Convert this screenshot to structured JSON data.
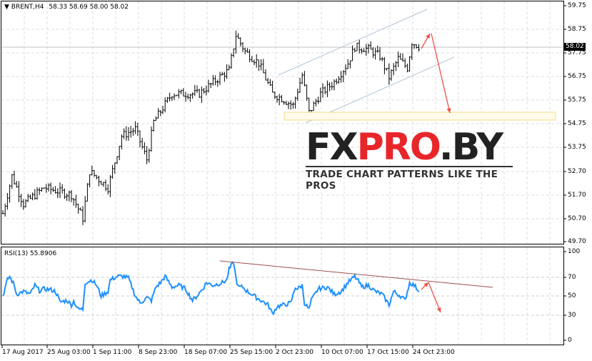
{
  "header": {
    "symbol": "BRENT,H4",
    "ohlc": "58.33 58.69 58.00 58.02"
  },
  "current_price": "58.02",
  "rsi": {
    "label": "RSI(13) 55.8906",
    "levels": [
      "100",
      "70",
      "50",
      "30",
      "0"
    ]
  },
  "price_axis": [
    "59.75",
    "58.75",
    "57.75",
    "56.75",
    "55.75",
    "54.75",
    "53.75",
    "52.70",
    "51.70",
    "50.70",
    "49.70"
  ],
  "time_axis": [
    "17 Aug 2017",
    "25 Aug 03:00",
    "1 Sep 11:00",
    "8 Sep 23:00",
    "18 Sep 07:00",
    "25 Sep 15:00",
    "2 Oct 23:00",
    "10 Oct 07:00",
    "17 Oct 15:00",
    "24 Oct 23:00"
  ],
  "logo": {
    "part1": "FX",
    "part2": "PRO",
    "part3": ".BY",
    "tagline": "TRADE CHART PATTERNS LIKE THE PROS"
  },
  "colors": {
    "bars": "#000000",
    "rsi": "#1e90ff",
    "arrows": "#f0504a",
    "channel": "#b0c4d8",
    "zone": "#f5d98a",
    "rsi_trend": "#a05050"
  },
  "chart_data": {
    "type": "ohlc",
    "price_path_anchors": [
      [
        0,
        50.9
      ],
      [
        4,
        52.5
      ],
      [
        9,
        51.3
      ],
      [
        18,
        52.0
      ],
      [
        30,
        51.7
      ],
      [
        35,
        50.7
      ],
      [
        38,
        52.7
      ],
      [
        46,
        52.0
      ],
      [
        52,
        54.2
      ],
      [
        58,
        54.5
      ],
      [
        63,
        53.2
      ],
      [
        66,
        54.8
      ],
      [
        74,
        56.0
      ],
      [
        86,
        56.0
      ],
      [
        96,
        56.8
      ],
      [
        99,
        57.0
      ],
      [
        102,
        58.5
      ],
      [
        106,
        57.8
      ],
      [
        112,
        57.3
      ],
      [
        118,
        56.0
      ],
      [
        122,
        55.8
      ],
      [
        127,
        55.5
      ],
      [
        131,
        56.8
      ],
      [
        134,
        55.2
      ],
      [
        139,
        56.0
      ],
      [
        145,
        56.5
      ],
      [
        151,
        57.3
      ],
      [
        154,
        58.0
      ],
      [
        160,
        57.9
      ],
      [
        165,
        57.6
      ],
      [
        169,
        56.7
      ],
      [
        173,
        57.5
      ],
      [
        177,
        57.1
      ],
      [
        179,
        58.2
      ],
      [
        182,
        58.02
      ]
    ],
    "rsi_anchors": [
      [
        0,
        50
      ],
      [
        2,
        68
      ],
      [
        3,
        72
      ],
      [
        5,
        62
      ],
      [
        6,
        52
      ],
      [
        9,
        55
      ],
      [
        12,
        52
      ],
      [
        14,
        62
      ],
      [
        16,
        56
      ],
      [
        18,
        58
      ],
      [
        21,
        57
      ],
      [
        23,
        55
      ],
      [
        24,
        50
      ],
      [
        25,
        43
      ],
      [
        28,
        45
      ],
      [
        30,
        40
      ],
      [
        31,
        44
      ],
      [
        33,
        35
      ],
      [
        35,
        35
      ],
      [
        36,
        65
      ],
      [
        39,
        68
      ],
      [
        41,
        62
      ],
      [
        43,
        50
      ],
      [
        46,
        55
      ],
      [
        47,
        68
      ],
      [
        50,
        72
      ],
      [
        53,
        72
      ],
      [
        55,
        70
      ],
      [
        58,
        50
      ],
      [
        60,
        42
      ],
      [
        63,
        48
      ],
      [
        65,
        45
      ],
      [
        67,
        60
      ],
      [
        69,
        65
      ],
      [
        71,
        72
      ],
      [
        74,
        60
      ],
      [
        77,
        62
      ],
      [
        80,
        58
      ],
      [
        83,
        45
      ],
      [
        85,
        50
      ],
      [
        88,
        60
      ],
      [
        89,
        65
      ],
      [
        92,
        62
      ],
      [
        96,
        65
      ],
      [
        98,
        68
      ],
      [
        99,
        80
      ],
      [
        101,
        88
      ],
      [
        102,
        70
      ],
      [
        103,
        60
      ],
      [
        105,
        60
      ],
      [
        107,
        55
      ],
      [
        109,
        52
      ],
      [
        111,
        48
      ],
      [
        113,
        45
      ],
      [
        116,
        40
      ],
      [
        118,
        30
      ],
      [
        120,
        38
      ],
      [
        123,
        40
      ],
      [
        126,
        42
      ],
      [
        128,
        60
      ],
      [
        129,
        58
      ],
      [
        131,
        62
      ],
      [
        132,
        42
      ],
      [
        134,
        35
      ],
      [
        135,
        45
      ],
      [
        138,
        58
      ],
      [
        142,
        60
      ],
      [
        145,
        52
      ],
      [
        148,
        55
      ],
      [
        151,
        65
      ],
      [
        154,
        72
      ],
      [
        156,
        65
      ],
      [
        157,
        60
      ],
      [
        160,
        62
      ],
      [
        163,
        55
      ],
      [
        166,
        52
      ],
      [
        169,
        40
      ],
      [
        171,
        55
      ],
      [
        174,
        50
      ],
      [
        176,
        45
      ],
      [
        178,
        65
      ],
      [
        180,
        62
      ],
      [
        182,
        56
      ]
    ],
    "price_range": [
      49.7,
      59.75
    ],
    "rsi_range": [
      0,
      100
    ]
  }
}
